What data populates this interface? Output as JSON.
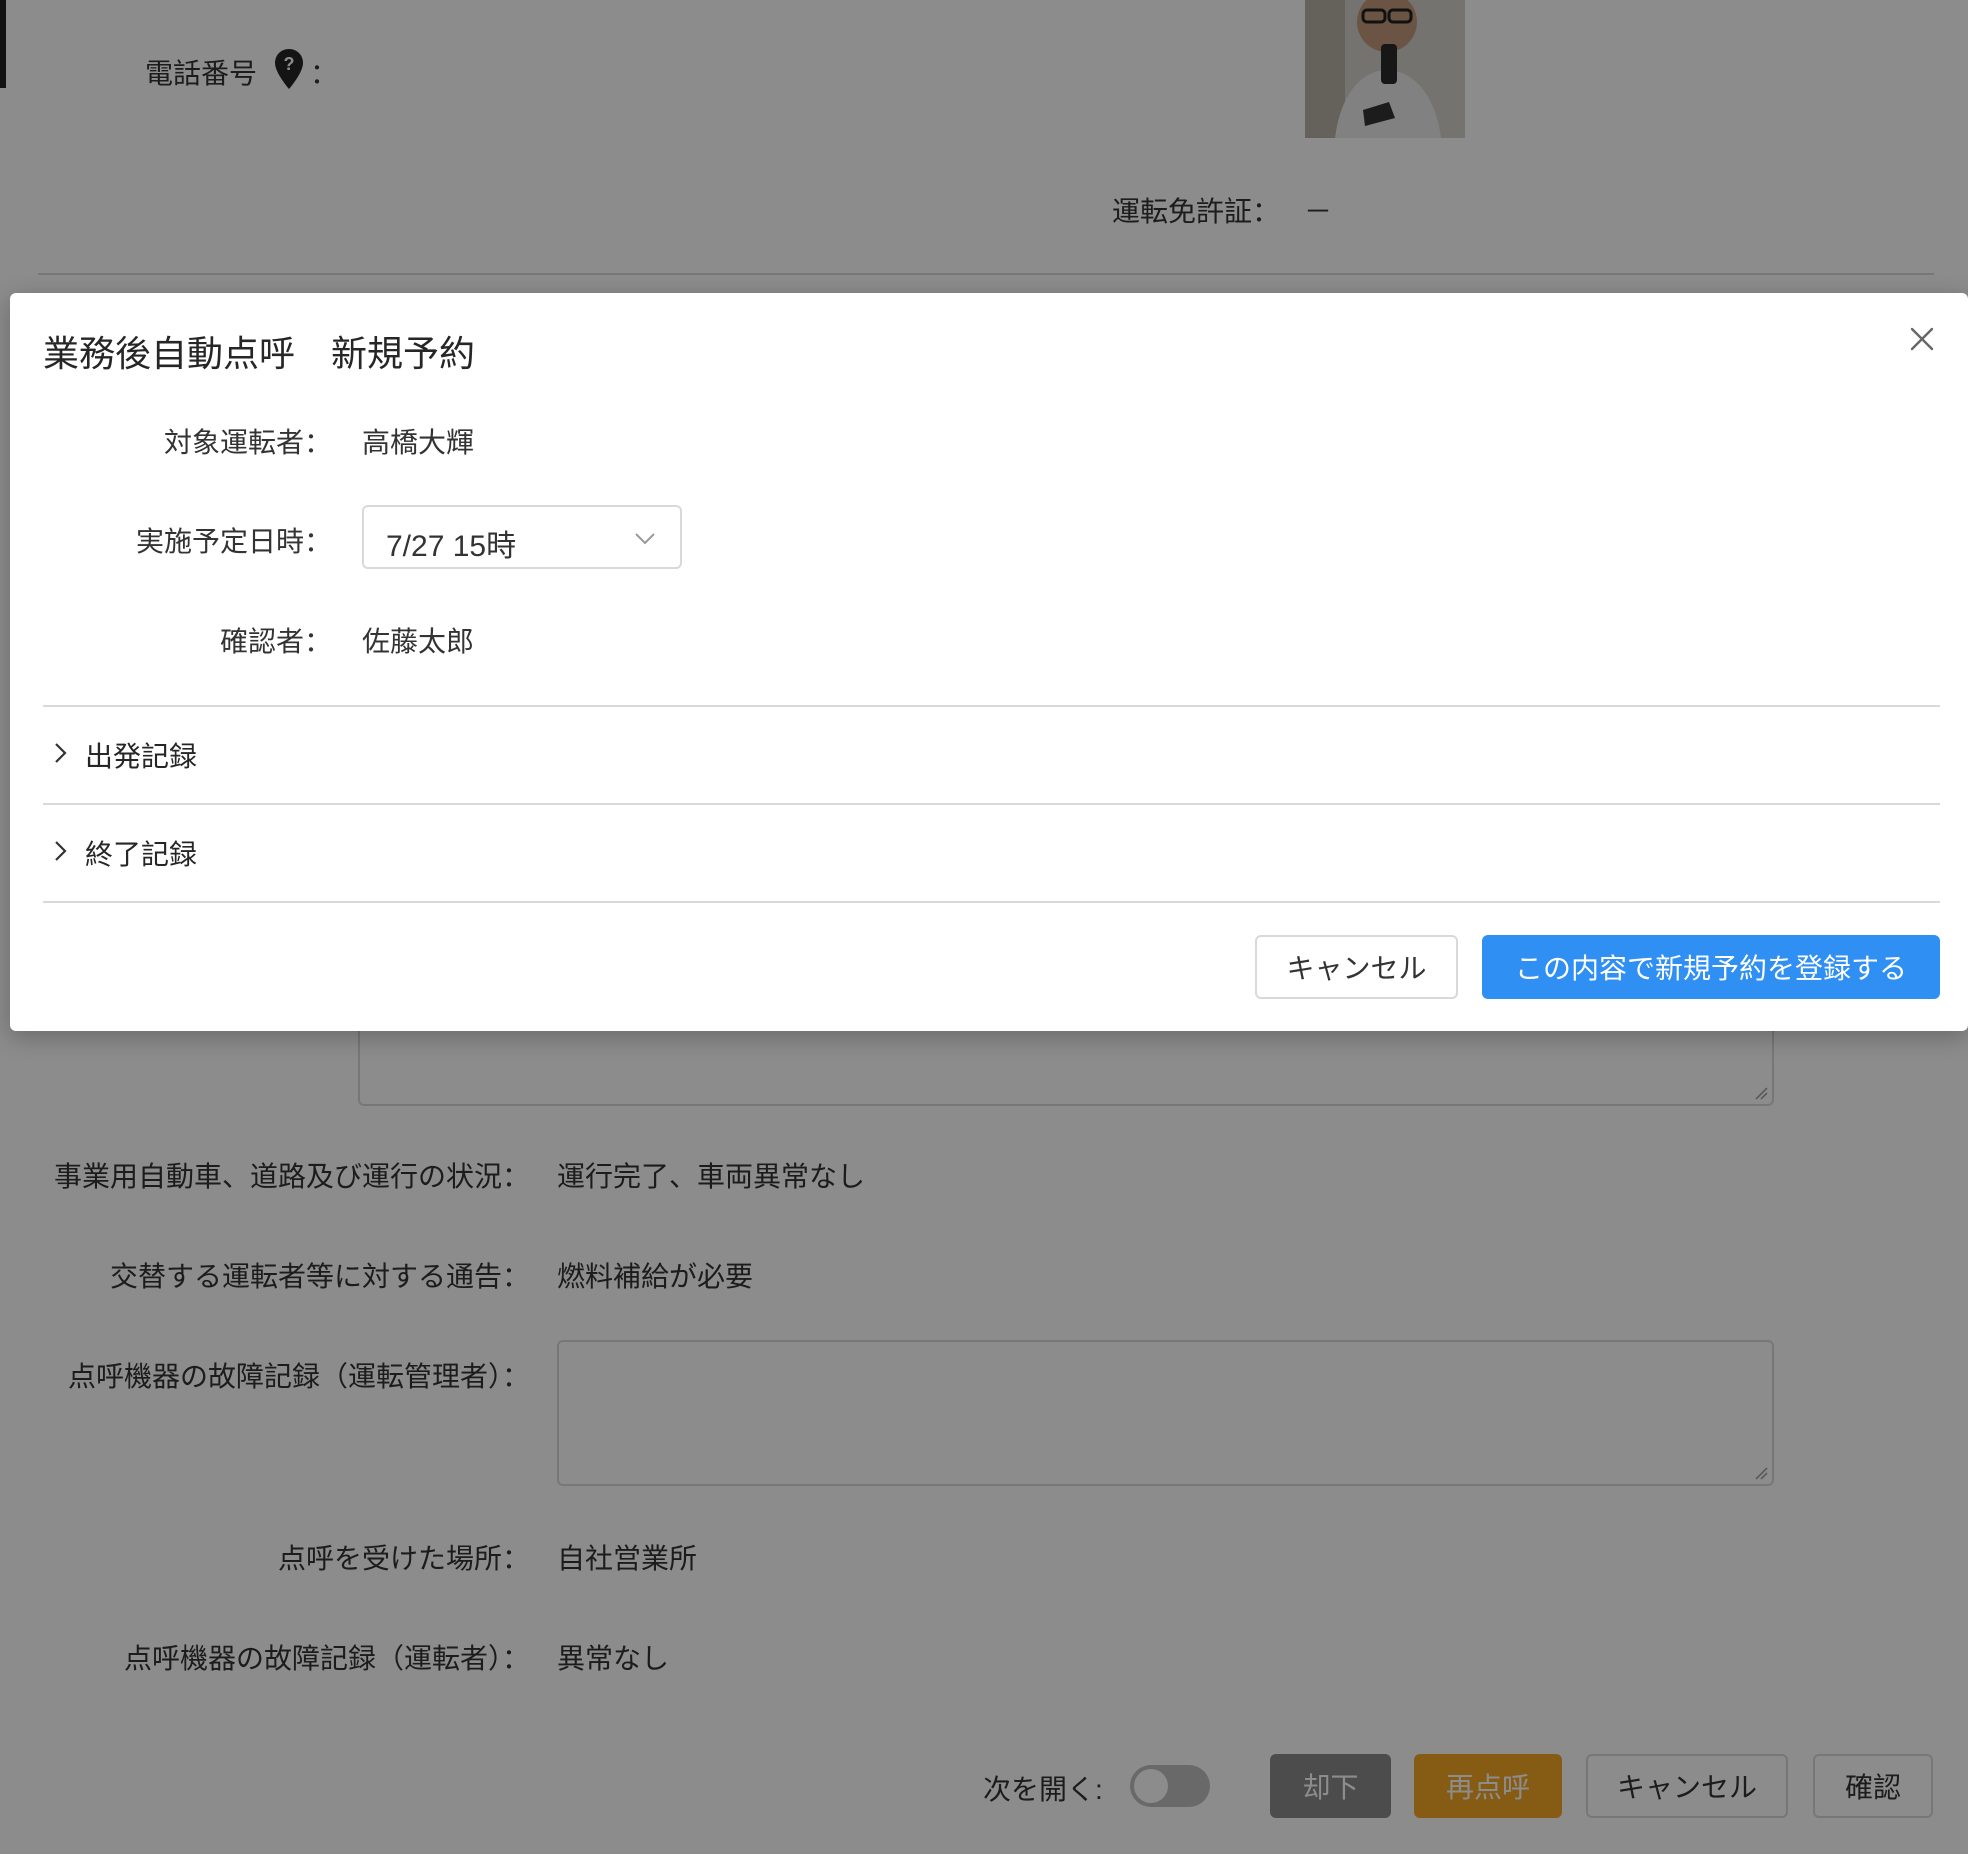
{
  "background": {
    "phone_label": "電話番号",
    "phone_colon": "：",
    "license_label": "運転免許証：",
    "license_value": "－",
    "road_label": "事業用自動車、道路及び運行の状況：",
    "road_value": "運行完了、車両異常なし",
    "notice_label": "交替する運転者等に対する通告：",
    "notice_value": "燃料補給が必要",
    "device_fault_manager_label": "点呼機器の故障記録（運転管理者）：",
    "place_label": "点呼を受けた場所：",
    "place_value": "自社営業所",
    "device_fault_driver_label": "点呼機器の故障記録（運転者）：",
    "device_fault_driver_value": "異常なし",
    "footer": {
      "next_open_label": "次を開く:",
      "reject_label": "却下",
      "recall_label": "再点呼",
      "cancel_label": "キャンセル",
      "confirm_label": "確認"
    }
  },
  "modal": {
    "title": "業務後自動点呼　新規予約",
    "driver_label": "対象運転者：",
    "driver_value": "高橋大輝",
    "scheduled_label": "実施予定日時：",
    "scheduled_value": "7/27 15時",
    "confirmer_label": "確認者：",
    "confirmer_value": "佐藤太郎",
    "sections": [
      "出発記録",
      "終了記録"
    ],
    "cancel_label": "キャンセル",
    "submit_label": "この内容で新規予約を登録する"
  },
  "colors": {
    "primary": "#2f8ff2",
    "warning": "#f5a623",
    "danger_dark": "#7a7a7a",
    "overlay": "rgba(0,0,0,0.45)"
  },
  "icons": [
    "location-help-icon",
    "close-icon",
    "chevron-down-icon",
    "chevron-right-icon",
    "resize-handle-icon"
  ]
}
